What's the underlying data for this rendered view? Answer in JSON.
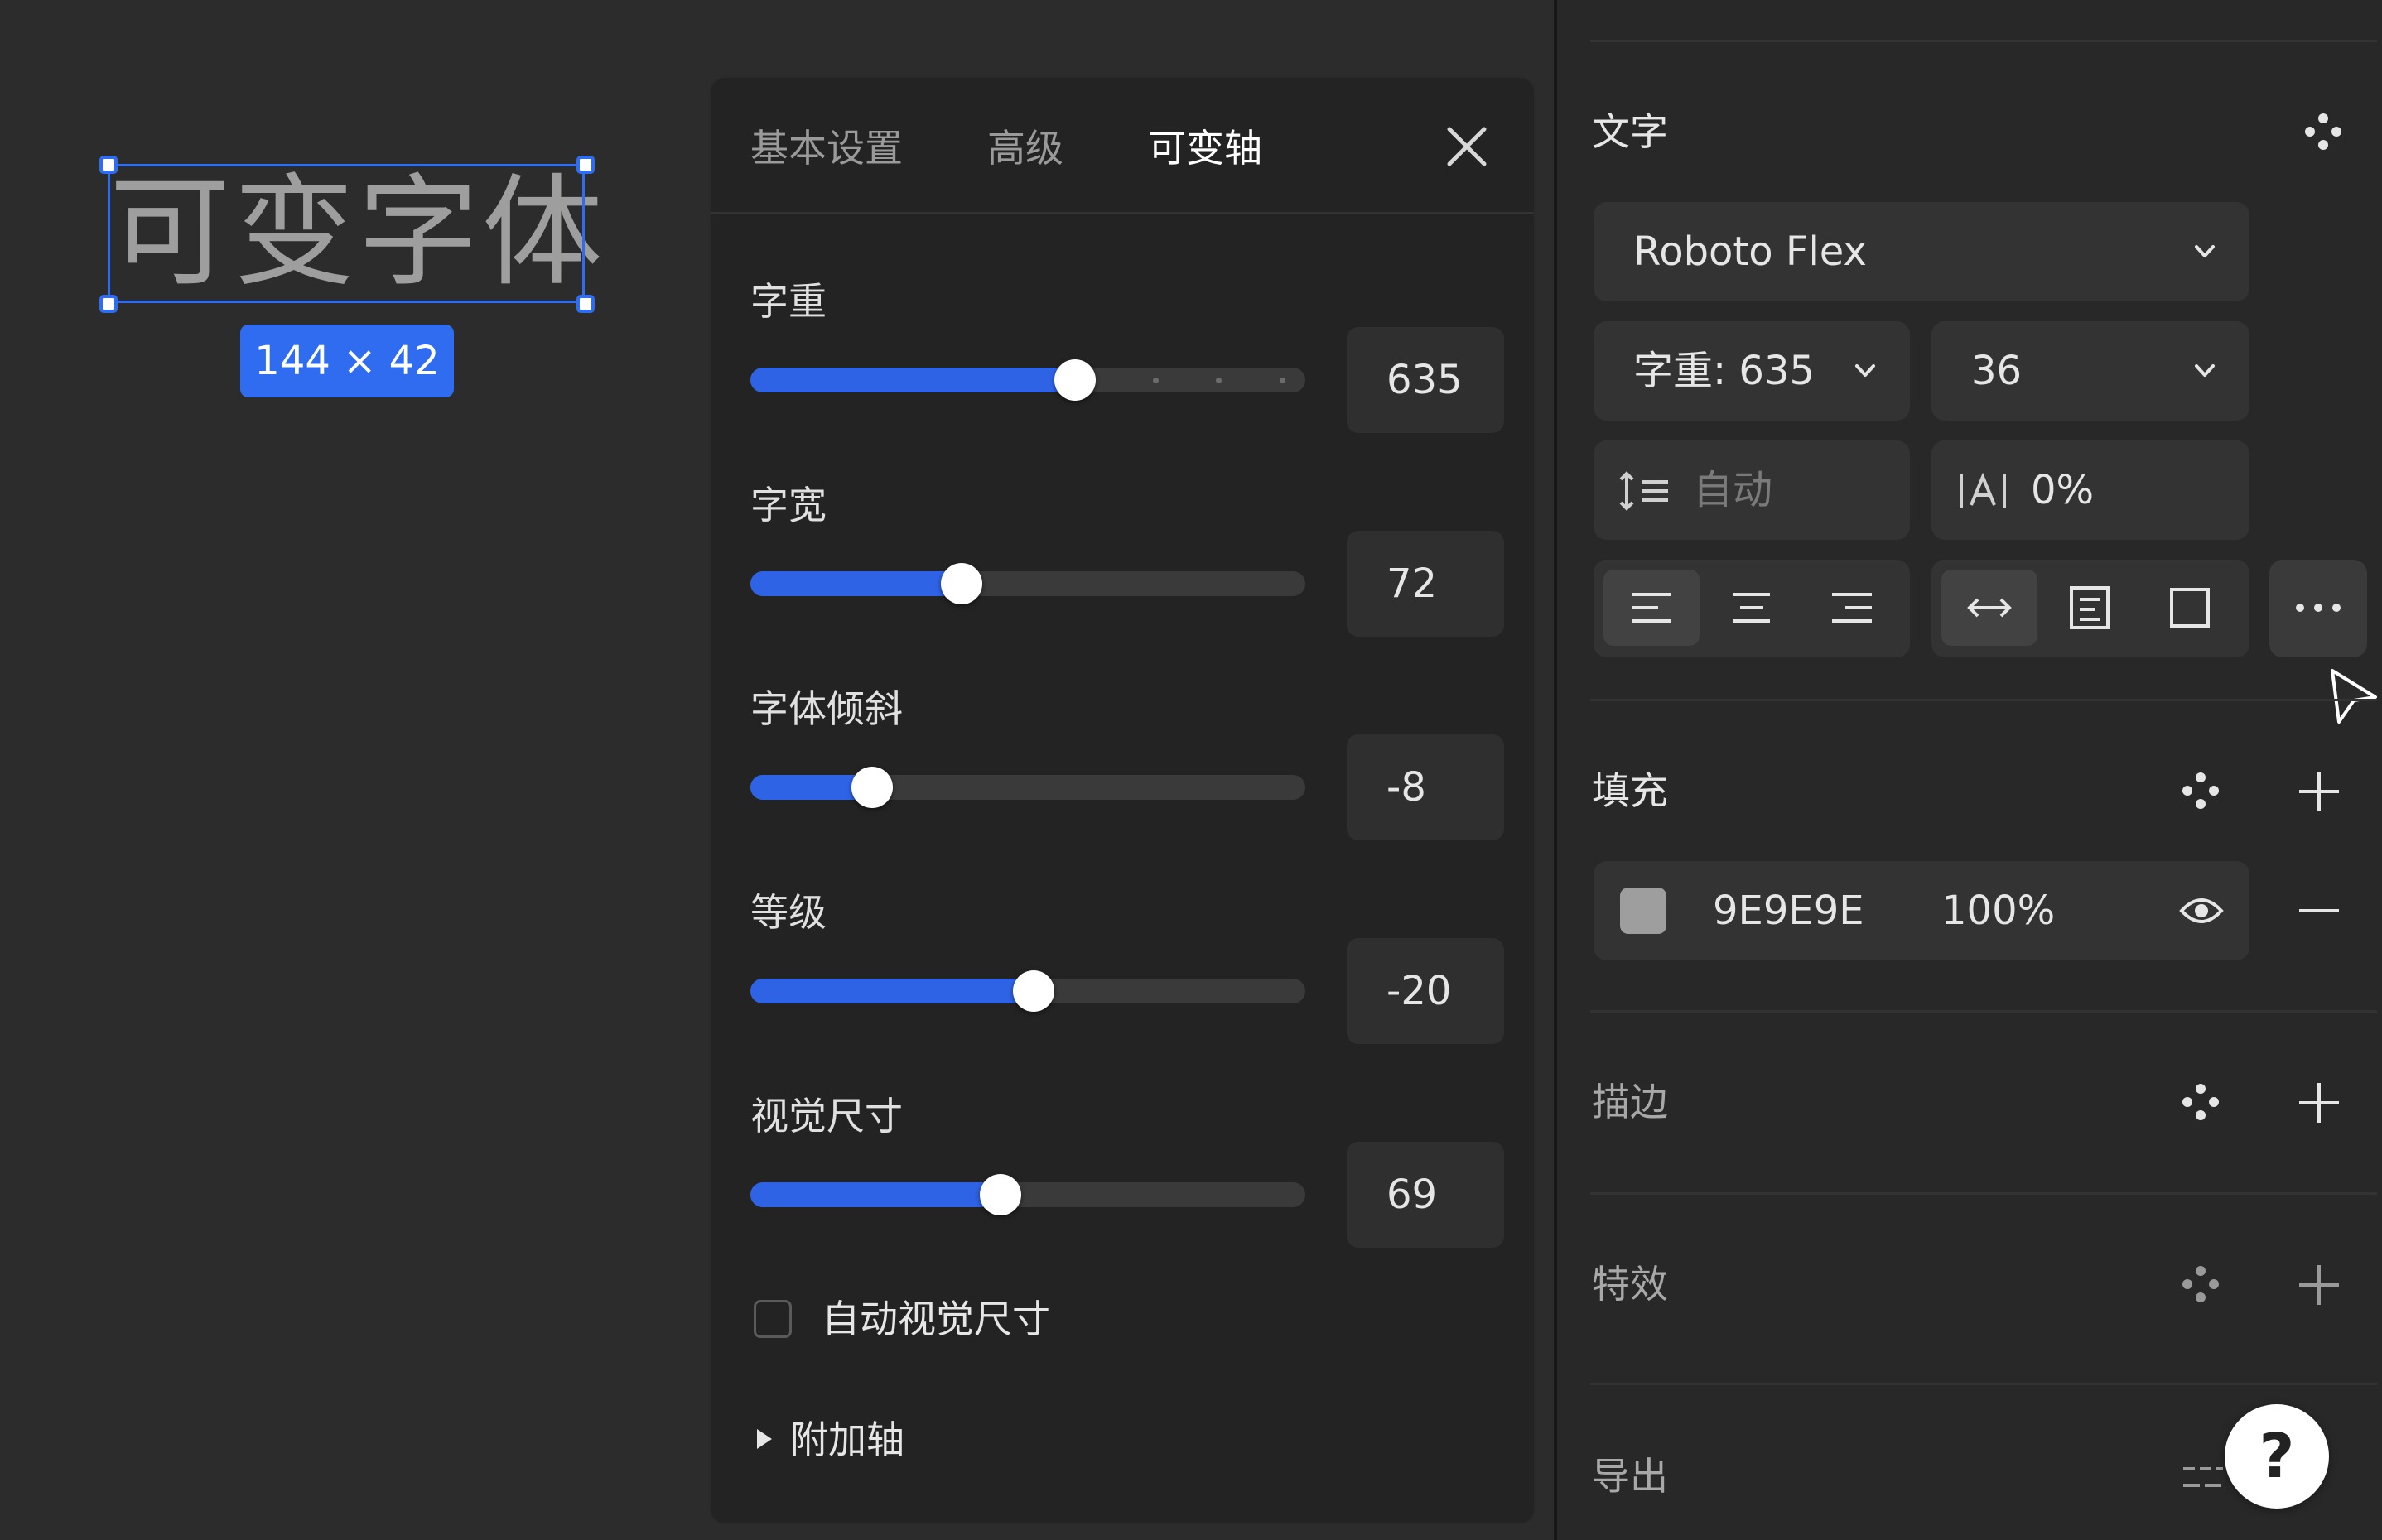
{
  "canvas": {
    "selected_text": "可变字体",
    "size_badge": "144 × 42"
  },
  "axes_panel": {
    "tabs": [
      {
        "label": "基本设置",
        "active": false
      },
      {
        "label": "高级",
        "active": false
      },
      {
        "label": "可变轴",
        "active": true
      }
    ],
    "axes": [
      {
        "label": "字重",
        "value": "635",
        "fraction": 0.585
      },
      {
        "label": "字宽",
        "value": "72",
        "fraction": 0.38
      },
      {
        "label": "字体倾斜",
        "value": "-8",
        "fraction": 0.22
      },
      {
        "label": "等级",
        "value": "-20",
        "fraction": 0.51
      },
      {
        "label": "视觉尺寸",
        "value": "69",
        "fraction": 0.45
      }
    ],
    "auto_optical_size_label": "自动视觉尺寸",
    "auto_optical_size_checked": false,
    "extra_axes_label": "附加轴"
  },
  "text_panel": {
    "title": "文字",
    "font_family": "Roboto Flex",
    "weight_label": "字重: 635",
    "font_size": "36",
    "line_height_placeholder": "自动",
    "letter_spacing": "0%",
    "align_active": "left",
    "resize_active": "auto-width"
  },
  "fill": {
    "title": "填充",
    "color_hex": "9E9E9E",
    "swatch_color": "#9e9e9e",
    "opacity": "100%"
  },
  "stroke": {
    "title": "描边"
  },
  "effects": {
    "title": "特效"
  },
  "export": {
    "title": "导出"
  },
  "help": {
    "label": "?"
  },
  "colors": {
    "accent": "#2f6cf0",
    "slider_fill": "#2f63e6",
    "panel_bg": "#232323",
    "canvas_bg": "#2c2c2c"
  }
}
